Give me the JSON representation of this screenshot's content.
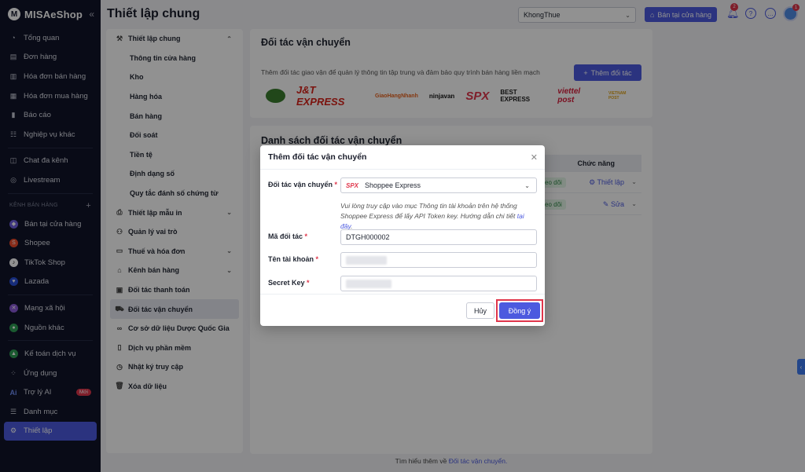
{
  "app": {
    "logo_text": "MISAeShop",
    "logo_mark": "M"
  },
  "sidebar": {
    "items": [
      {
        "label": "Tổng quan",
        "icon": "dashboard-icon"
      },
      {
        "label": "Đơn hàng",
        "icon": "order-icon"
      },
      {
        "label": "Hóa đơn bán hàng",
        "icon": "invoice-icon"
      },
      {
        "label": "Hóa đơn mua hàng",
        "icon": "purchase-icon"
      },
      {
        "label": "Báo cáo",
        "icon": "report-icon"
      },
      {
        "label": "Nghiệp vụ khác",
        "icon": "tasks-icon"
      }
    ],
    "items2": [
      {
        "label": "Chat đa kênh",
        "icon": "chat-icon"
      },
      {
        "label": "Livestream",
        "icon": "livestream-icon"
      }
    ],
    "channel_group_label": "KÊNH BÁN HÀNG",
    "channels": [
      {
        "label": "Bán tại cửa hàng",
        "color": "#6f5fe0"
      },
      {
        "label": "Shopee",
        "color": "#ee4d2d"
      },
      {
        "label": "TikTok Shop",
        "color": "#ffffff"
      },
      {
        "label": "Lazada",
        "color": "#2a4fd8"
      }
    ],
    "items3": [
      {
        "label": "Mạng xã hội",
        "color": "#8c5ad8"
      },
      {
        "label": "Nguồn khác",
        "color": "#2f9e55"
      }
    ],
    "items4": [
      {
        "label": "Kế toán dịch vụ",
        "icon": "accounting-icon"
      },
      {
        "label": "Ứng dụng",
        "icon": "apps-icon"
      },
      {
        "label": "Trợ lý AI",
        "icon": "ai-icon",
        "badge": "Mới"
      },
      {
        "label": "Danh mục",
        "icon": "list-icon"
      },
      {
        "label": "Thiết lập",
        "icon": "settings-icon"
      }
    ]
  },
  "header": {
    "title": "Thiết lập chung",
    "store_value": "KhongThue",
    "pos_button": "Bán tại cửa hàng",
    "notif_count": "2",
    "avatar_badge": "1"
  },
  "settings_menu": {
    "general": "Thiết lập chung",
    "general_sub": [
      "Thông tin cửa hàng",
      "Kho",
      "Hàng hóa",
      "Bán hàng",
      "Đối soát",
      "Tiền tệ",
      "Định dạng số",
      "Quy tắc đánh số chứng từ"
    ],
    "print_templates": "Thiết lập mẫu in",
    "roles": "Quản lý vai trò",
    "tax": "Thuế và hóa đơn",
    "channels": "Kênh bán hàng",
    "payment": "Đối tác thanh toán",
    "shipping": "Đối tác vận chuyển",
    "pharma": "Cơ sở dữ liệu Dược Quốc Gia",
    "services": "Dịch vụ phần mềm",
    "log": "Nhật ký truy cập",
    "delete": "Xóa dữ liệu"
  },
  "carrier_card": {
    "title": "Đối tác vận chuyển",
    "description": "Thêm đối tác giao vận để quản lý thông tin tập trung và đảm bảo quy trình bán hàng liền mạch",
    "add_button": "Thêm đối tác",
    "logos": [
      "J&T EXPRESS",
      "GiaoHangNhanh",
      "ninjavan",
      "SPX",
      "BEST EXPRESS",
      "viettel post",
      "VIETNAM POST"
    ]
  },
  "list_card": {
    "title": "Danh sách đối tác vận chuyển",
    "func_header": "Chức năng",
    "rows": [
      {
        "status": "eo dõi",
        "action": "Thiết lập"
      },
      {
        "status": "eo dõi",
        "action": "Sửa"
      }
    ]
  },
  "footer": {
    "prefix": "Tìm hiểu thêm về",
    "link": "Đối tác vận chuyển."
  },
  "modal": {
    "title": "Thêm đối tác vận chuyển",
    "partner_label": "Đối tác vận chuyển",
    "partner_value": "Shoppee Express",
    "partner_logo": "SPX",
    "hint": "Vui lòng truy cập vào mục Thông tin tài khoản trên hệ thống Shoppee Express để lấy API Token key. Hướng dẫn chi tiết",
    "hint_link": "tại đây",
    "code_label": "Mã đối tác",
    "code_value": "DTGH000002",
    "account_label": "Tên tài khoản",
    "secret_label": "Secret Key",
    "cancel": "Hủy",
    "ok": "Đồng ý"
  }
}
